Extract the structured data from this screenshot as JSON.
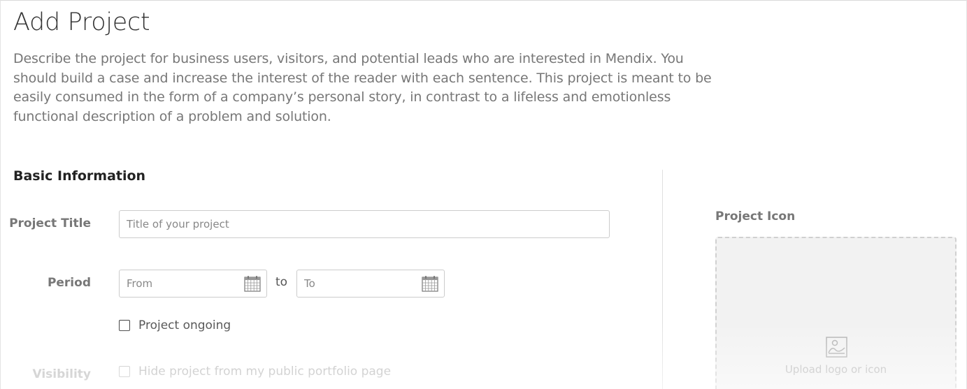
{
  "page": {
    "title": "Add Project",
    "intro": "Describe the project for business users, visitors, and potential leads who are interested in Mendix. You should build a case and increase the interest of the reader with each sentence. This project is meant to be easily consumed in the form of a company’s personal story, in contrast to a lifeless and emotionless functional description of a problem and solution."
  },
  "basic_info": {
    "heading": "Basic Information",
    "project_title": {
      "label": "Project Title",
      "value": "",
      "placeholder": "Title of your project"
    },
    "period": {
      "label": "Period",
      "from": {
        "value": "",
        "placeholder": "From",
        "icon": "calendar-icon"
      },
      "separator": "to",
      "to": {
        "value": "",
        "placeholder": "To",
        "icon": "calendar-icon"
      }
    },
    "ongoing": {
      "label": "Project ongoing",
      "checked": false
    },
    "visibility": {
      "label": "Visibility",
      "option_label": "Hide project from my public portfolio page",
      "checked": false
    }
  },
  "project_icon": {
    "heading": "Project Icon",
    "upload_text": "Upload logo or icon",
    "icon": "image-icon"
  },
  "colors": {
    "label_gray": "#777777",
    "border": "#cccccc",
    "upload_bg": "#f2f2f2"
  }
}
